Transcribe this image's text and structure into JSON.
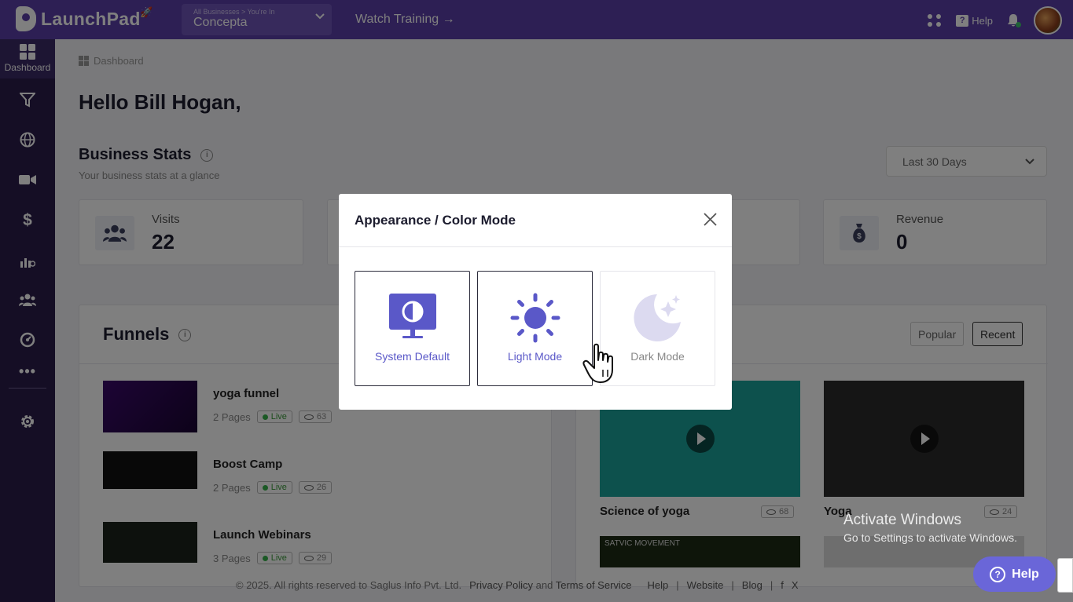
{
  "topbar": {
    "logo_text": "LaunchPad",
    "crumb": "All Businesses > You're In",
    "business": "Concepta",
    "watch_training": "Watch Training →",
    "help": "Help"
  },
  "sidebar": {
    "items": [
      {
        "label": "Dashboard",
        "icon": "dashboard-icon"
      },
      {
        "label": "",
        "icon": "funnel-icon"
      },
      {
        "label": "",
        "icon": "globe-icon"
      },
      {
        "label": "",
        "icon": "video-icon"
      },
      {
        "label": "",
        "icon": "dollar-icon"
      },
      {
        "label": "",
        "icon": "analytics-icon"
      },
      {
        "label": "",
        "icon": "users-icon"
      },
      {
        "label": "",
        "icon": "gauge-icon"
      },
      {
        "label": "",
        "icon": "more-icon"
      },
      {
        "label": "",
        "icon": "gear-icon"
      }
    ]
  },
  "main": {
    "breadcrumb": "Dashboard",
    "greeting": "Hello Bill Hogan,",
    "stats_title": "Business Stats",
    "stats_subtitle": "Your business stats at a glance",
    "range": "Last 30 Days",
    "stats": [
      {
        "label": "Visits",
        "value": "22"
      },
      {
        "label": "Revenue",
        "value": "0"
      }
    ],
    "funnels_title": "Funnels",
    "funnels": [
      {
        "name": "yoga funnel",
        "pages": "2 Pages",
        "status": "Live",
        "views": "63"
      },
      {
        "name": "Boost Camp",
        "pages": "2 Pages",
        "status": "Live",
        "views": "26"
      },
      {
        "name": "Launch Webinars",
        "pages": "3 Pages",
        "status": "Live",
        "views": "29"
      }
    ],
    "video_tabs": [
      "Popular",
      "Recent"
    ],
    "videos": [
      {
        "title": "Science of yoga",
        "views": "68"
      },
      {
        "title": "Yoga",
        "views": "24"
      }
    ],
    "video_thumb_text": "SATVIC MOVEMENT"
  },
  "footer": {
    "copyright": "© 2025. All rights reserved to Saglus Info Pvt. Ltd.",
    "privacy": "Privacy Policy",
    "and": "and",
    "terms": "Terms of Service",
    "help": "Help",
    "website": "Website",
    "blog": "Blog",
    "sep": "|",
    "social_f": "f",
    "social_x": "X"
  },
  "modal": {
    "title": "Appearance / Color Mode",
    "options": [
      {
        "label": "System Default",
        "icon": "monitor-contrast-icon"
      },
      {
        "label": "Light Mode",
        "icon": "sun-icon"
      },
      {
        "label": "Dark Mode",
        "icon": "moon-stars-icon"
      }
    ]
  },
  "watermark": {
    "line1": "Activate Windows",
    "line2": "Go to Settings to activate Windows."
  },
  "help_fab": "Help",
  "colors": {
    "brand": "#5b3fa8",
    "sidebar": "#2a1d4a",
    "accent": "#5a58c8"
  }
}
